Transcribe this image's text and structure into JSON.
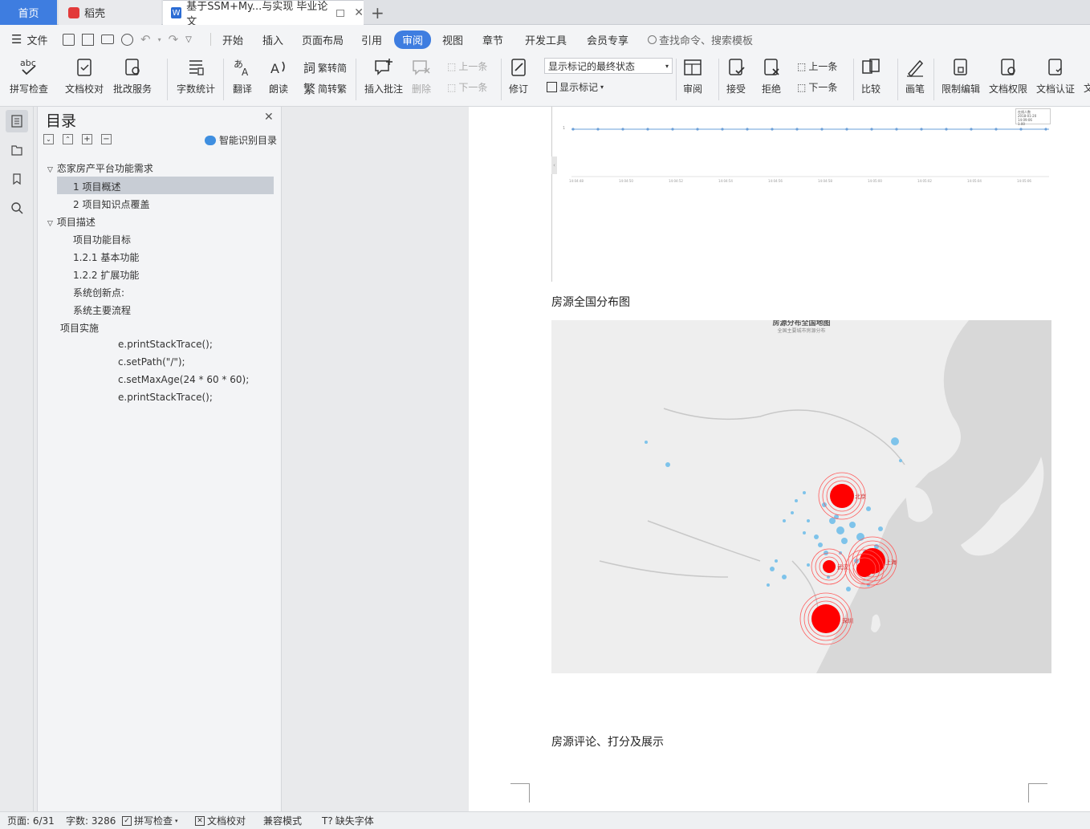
{
  "tabs": {
    "home": "首页",
    "daoke": "稻壳",
    "doc": "基于SSM+My...与实现 毕业论文",
    "add": "+"
  },
  "menu": {
    "file": "文件",
    "items": [
      "开始",
      "插入",
      "页面布局",
      "引用",
      "审阅",
      "视图",
      "章节",
      "开发工具",
      "会员专享"
    ],
    "search": "查找命令、搜索模板"
  },
  "ribbon": {
    "spell": "拼写检查",
    "proof": "文档校对",
    "batch": "批改服务",
    "wordcount": "字数统计",
    "translate": "翻译",
    "read": "朗读",
    "to_simple": "繁转简",
    "to_trad": "简转繁",
    "insert_comment": "插入批注",
    "delete": "删除",
    "prev_comment": "上一条",
    "next_comment": "下一条",
    "revise": "修订",
    "markup_state": "显示标记的最终状态",
    "show_markup": "显示标记",
    "review": "审阅",
    "accept": "接受",
    "reject": "拒绝",
    "prev": "上一条",
    "next": "下一条",
    "compare": "比较",
    "pen": "画笔",
    "restrict": "限制编辑",
    "perm": "文档权限",
    "cert": "文档认证",
    "more": "文"
  },
  "toc": {
    "title": "目录",
    "smart": "智能识别目录",
    "items": [
      "恋家房产平台功能需求",
      "1    项目概述",
      "2    项目知识点覆盖",
      "项目描述",
      "项目功能目标",
      "1.2.1  基本功能",
      "1.2.2  扩展功能",
      "系统创新点:",
      "系统主要流程",
      "项目实施",
      "e.printStackTrace();",
      "c.setPath(\"/\");",
      "c.setMaxAge(24 * 60 * 60);",
      "e.printStackTrace();"
    ]
  },
  "doc": {
    "caption1": "房源全国分布图",
    "map_title": "房源分布全国地图",
    "map_subtitle": "全国主要城市房源分布",
    "cities": [
      "北京",
      "上海",
      "武汉",
      "深圳"
    ],
    "caption2": "房源评论、打分及展示",
    "tooltip_title": "在线人数",
    "tooltip_time": "2018-01-20 14:09:06",
    "tooltip_value": "1.00",
    "chart_y1": "1",
    "chart_xticks": [
      "14:04:48",
      "14:04:50",
      "14:04:52",
      "14:04:54",
      "14:04:56",
      "14:04:58",
      "14:05:00",
      "14:05:02",
      "14:05:04",
      "14:05:06"
    ]
  },
  "status": {
    "page": "页面: 6/31",
    "words": "字数: 3286",
    "spell": "拼写检查",
    "proof": "文档校对",
    "compat": "兼容模式",
    "missing_font": "缺失字体"
  },
  "colors": {
    "accent": "#3e7de0",
    "bubble_red": "#ff0000",
    "bubble_blue": "#7ec3ea"
  }
}
